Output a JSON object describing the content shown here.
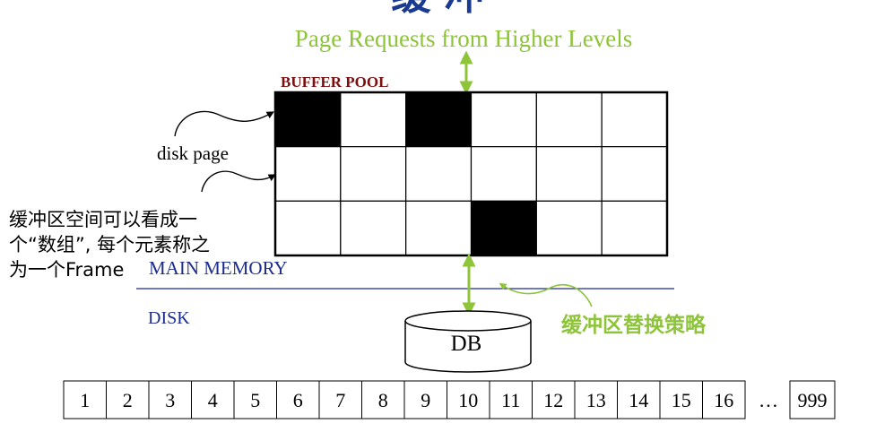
{
  "title_fragment": "缓 冲",
  "page_requests_label": "Page Requests from Higher Levels",
  "buffer_pool_label": "BUFFER POOL",
  "disk_page_label": "disk page",
  "frame_note_lines": [
    "缓冲区空间可以看成一",
    "个“数组”, 每个元素称之",
    "为一个Frame"
  ],
  "main_memory_label": "MAIN MEMORY",
  "disk_label": "DISK",
  "db_label": "DB",
  "replacement_policy_label": "缓冲区替换策略",
  "buffer_pool_grid": {
    "rows": 3,
    "cols": 6,
    "filled_frames": [
      [
        0,
        0
      ],
      [
        0,
        2
      ],
      [
        2,
        3
      ]
    ]
  },
  "disk_pages": [
    "1",
    "2",
    "3",
    "4",
    "5",
    "6",
    "7",
    "8",
    "9",
    "10",
    "11",
    "12",
    "13",
    "14",
    "15",
    "16"
  ],
  "ellipsis": "…",
  "last_page": "999",
  "colors": {
    "green": "#8dc43a",
    "dark_red": "#7a0f0f",
    "navy": "#1d2c8f",
    "title_blue": "#1a3a8f",
    "black": "#000000"
  }
}
